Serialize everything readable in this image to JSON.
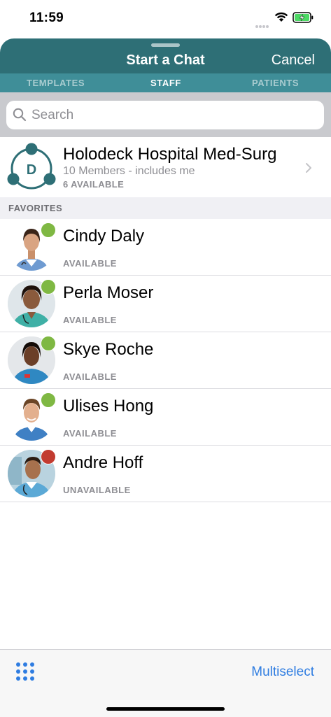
{
  "status_bar": {
    "time": "11:59"
  },
  "header": {
    "title": "Start a Chat",
    "cancel_label": "Cancel"
  },
  "tabs": [
    {
      "label": "TEMPLATES",
      "active": false
    },
    {
      "label": "STAFF",
      "active": true
    },
    {
      "label": "PATIENTS",
      "active": false
    }
  ],
  "search": {
    "placeholder": "Search",
    "value": ""
  },
  "group": {
    "initial": "D",
    "name": "Holodeck Hospital Med-Surg",
    "members": "10 Members - includes me",
    "available": "6 AVAILABLE"
  },
  "favorites": {
    "header": "FAVORITES",
    "items": [
      {
        "name": "Cindy Daly",
        "status": "AVAILABLE",
        "status_color": "#7fb843"
      },
      {
        "name": "Perla Moser",
        "status": "AVAILABLE",
        "status_color": "#7fb843"
      },
      {
        "name": "Skye Roche",
        "status": "AVAILABLE",
        "status_color": "#7fb843"
      },
      {
        "name": "Ulises Hong",
        "status": "AVAILABLE",
        "status_color": "#7fb843"
      },
      {
        "name": "Andre Hoff",
        "status": "UNAVAILABLE",
        "status_color": "#c23b30"
      }
    ]
  },
  "toolbar": {
    "multiselect_label": "Multiselect"
  },
  "colors": {
    "header_bg": "#2e6f76",
    "tabs_bg": "#3f8e98",
    "accent_blue": "#2f7de1"
  }
}
